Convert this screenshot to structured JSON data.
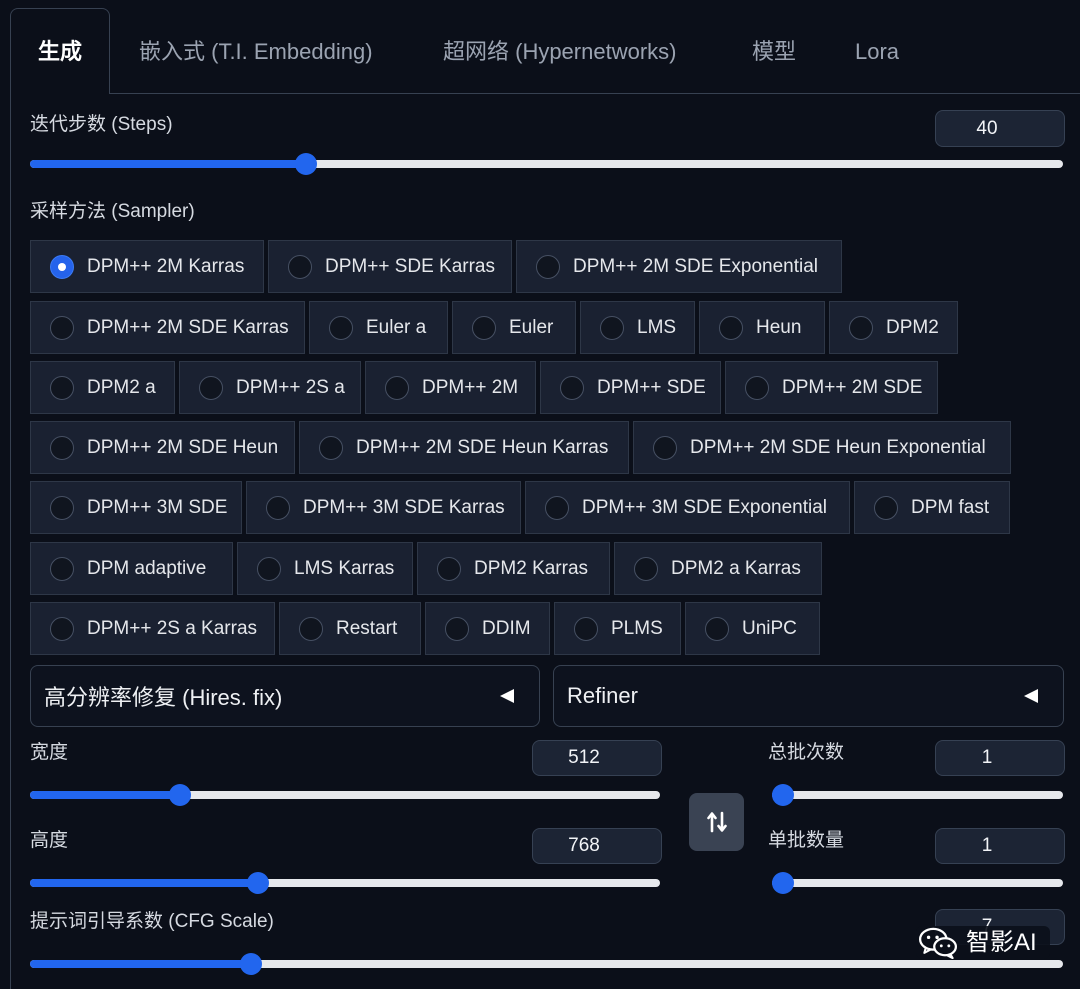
{
  "tabs": [
    {
      "label": "生成",
      "active": true
    },
    {
      "label": "嵌入式 (T.I. Embedding)",
      "active": false
    },
    {
      "label": "超网络 (Hypernetworks)",
      "active": false
    },
    {
      "label": "模型",
      "active": false
    },
    {
      "label": "Lora",
      "active": false
    }
  ],
  "steps": {
    "label": "迭代步数 (Steps)",
    "value": "40",
    "slider_level": 0.262
  },
  "sampler": {
    "label": "采样方法 (Sampler)",
    "selected_index": 0,
    "options": [
      "DPM++ 2M Karras",
      "DPM++ SDE Karras",
      "DPM++ 2M SDE Exponential",
      "DPM++ 2M SDE Karras",
      "Euler a",
      "Euler",
      "LMS",
      "Heun",
      "DPM2",
      "DPM2 a",
      "DPM++ 2S a",
      "DPM++ 2M",
      "DPM++ SDE",
      "DPM++ 2M SDE",
      "DPM++ 2M SDE Heun",
      "DPM++ 2M SDE Heun Karras",
      "DPM++ 2M SDE Heun Exponential",
      "DPM++ 3M SDE",
      "DPM++ 3M SDE Karras",
      "DPM++ 3M SDE Exponential",
      "DPM fast",
      "DPM adaptive",
      "LMS Karras",
      "DPM2 Karras",
      "DPM2 a Karras",
      "DPM++ 2S a Karras",
      "Restart",
      "DDIM",
      "PLMS",
      "UniPC"
    ]
  },
  "accordions": {
    "hires_fix": {
      "label": "高分辨率修复 (Hires. fix)",
      "expanded": false,
      "icon": "triangle-left-icon"
    },
    "refiner": {
      "label": "Refiner",
      "expanded": false,
      "icon": "triangle-left-icon"
    }
  },
  "width": {
    "label": "宽度",
    "value": "512",
    "slider_level": 0.229
  },
  "height": {
    "label": "高度",
    "value": "768",
    "slider_level": 0.357
  },
  "batch_count": {
    "label": "总批次数",
    "value": "1",
    "slider_level": 0
  },
  "batch_size": {
    "label": "单批数量",
    "value": "1",
    "slider_level": 0
  },
  "cfg_scale": {
    "label": "提示词引导系数 (CFG Scale)",
    "value": "7",
    "slider_level": 0.208
  },
  "swap_button": {
    "icon": "swap-icon"
  },
  "watermark": {
    "text": "智影AI",
    "icon": "wechat-icon"
  },
  "colors": {
    "background": "#0b0f19",
    "accent": "#2563eb",
    "border": "#374151",
    "slider_track": "#e6e8ec"
  }
}
